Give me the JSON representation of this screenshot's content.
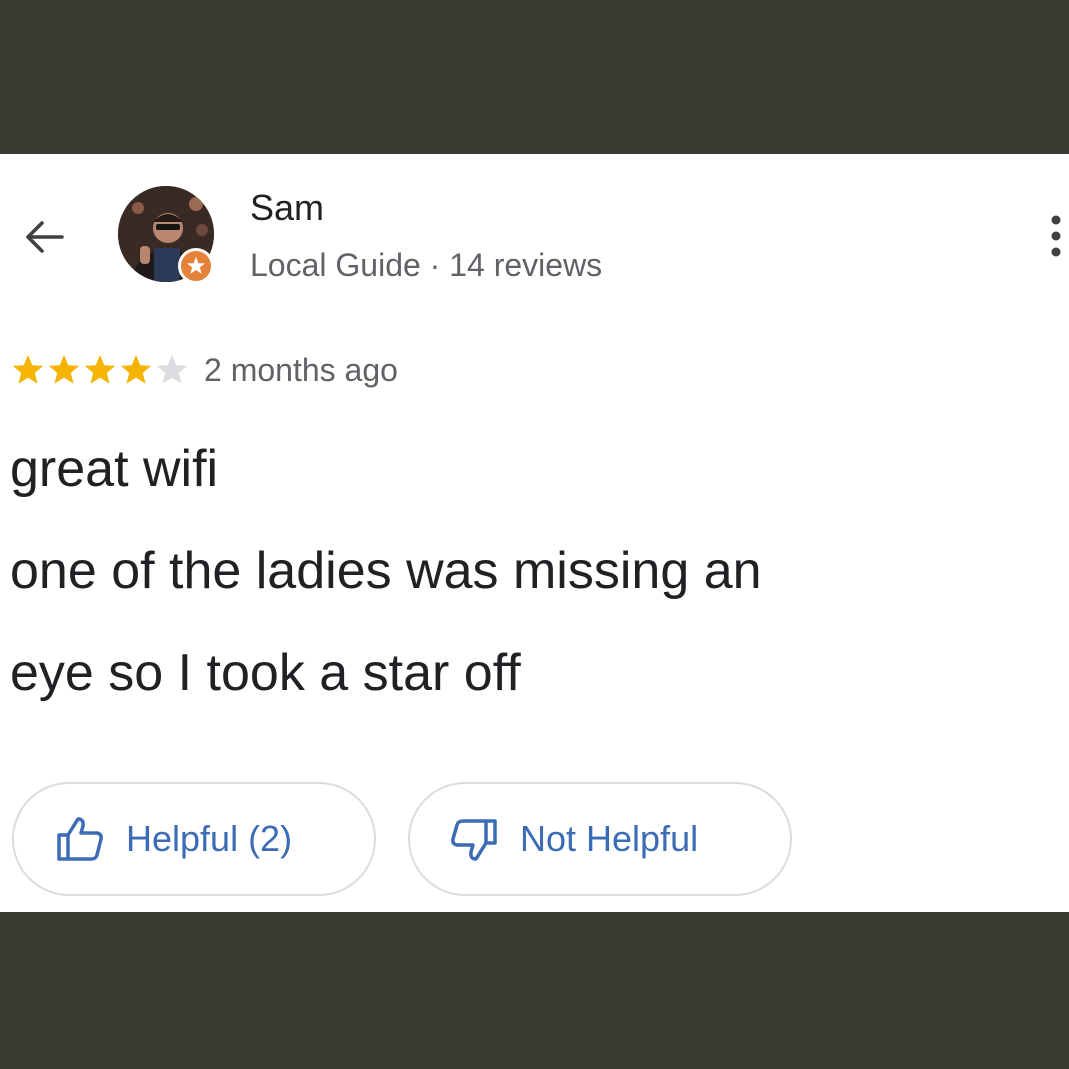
{
  "reviewer": {
    "name": "Sam",
    "meta": "Local Guide · 14 reviews",
    "badge_icon": "local-guide-star-icon",
    "badge_color": "#e4823b"
  },
  "review": {
    "rating": 4,
    "max_rating": 5,
    "star_color": "#f4b400",
    "empty_star_color": "#dadce0",
    "date": "2 months ago",
    "lines": [
      "great wifi",
      "one of the ladies was missing an",
      "eye so I took a star off"
    ]
  },
  "actions": {
    "back_icon": "arrow-left-icon",
    "more_icon": "more-vert-icon",
    "helpful_label": "Helpful (2)",
    "helpful_icon": "thumbs-up-icon",
    "not_helpful_label": "Not Helpful",
    "not_helpful_icon": "thumbs-down-icon",
    "accent_color": "#3b6cb5"
  }
}
